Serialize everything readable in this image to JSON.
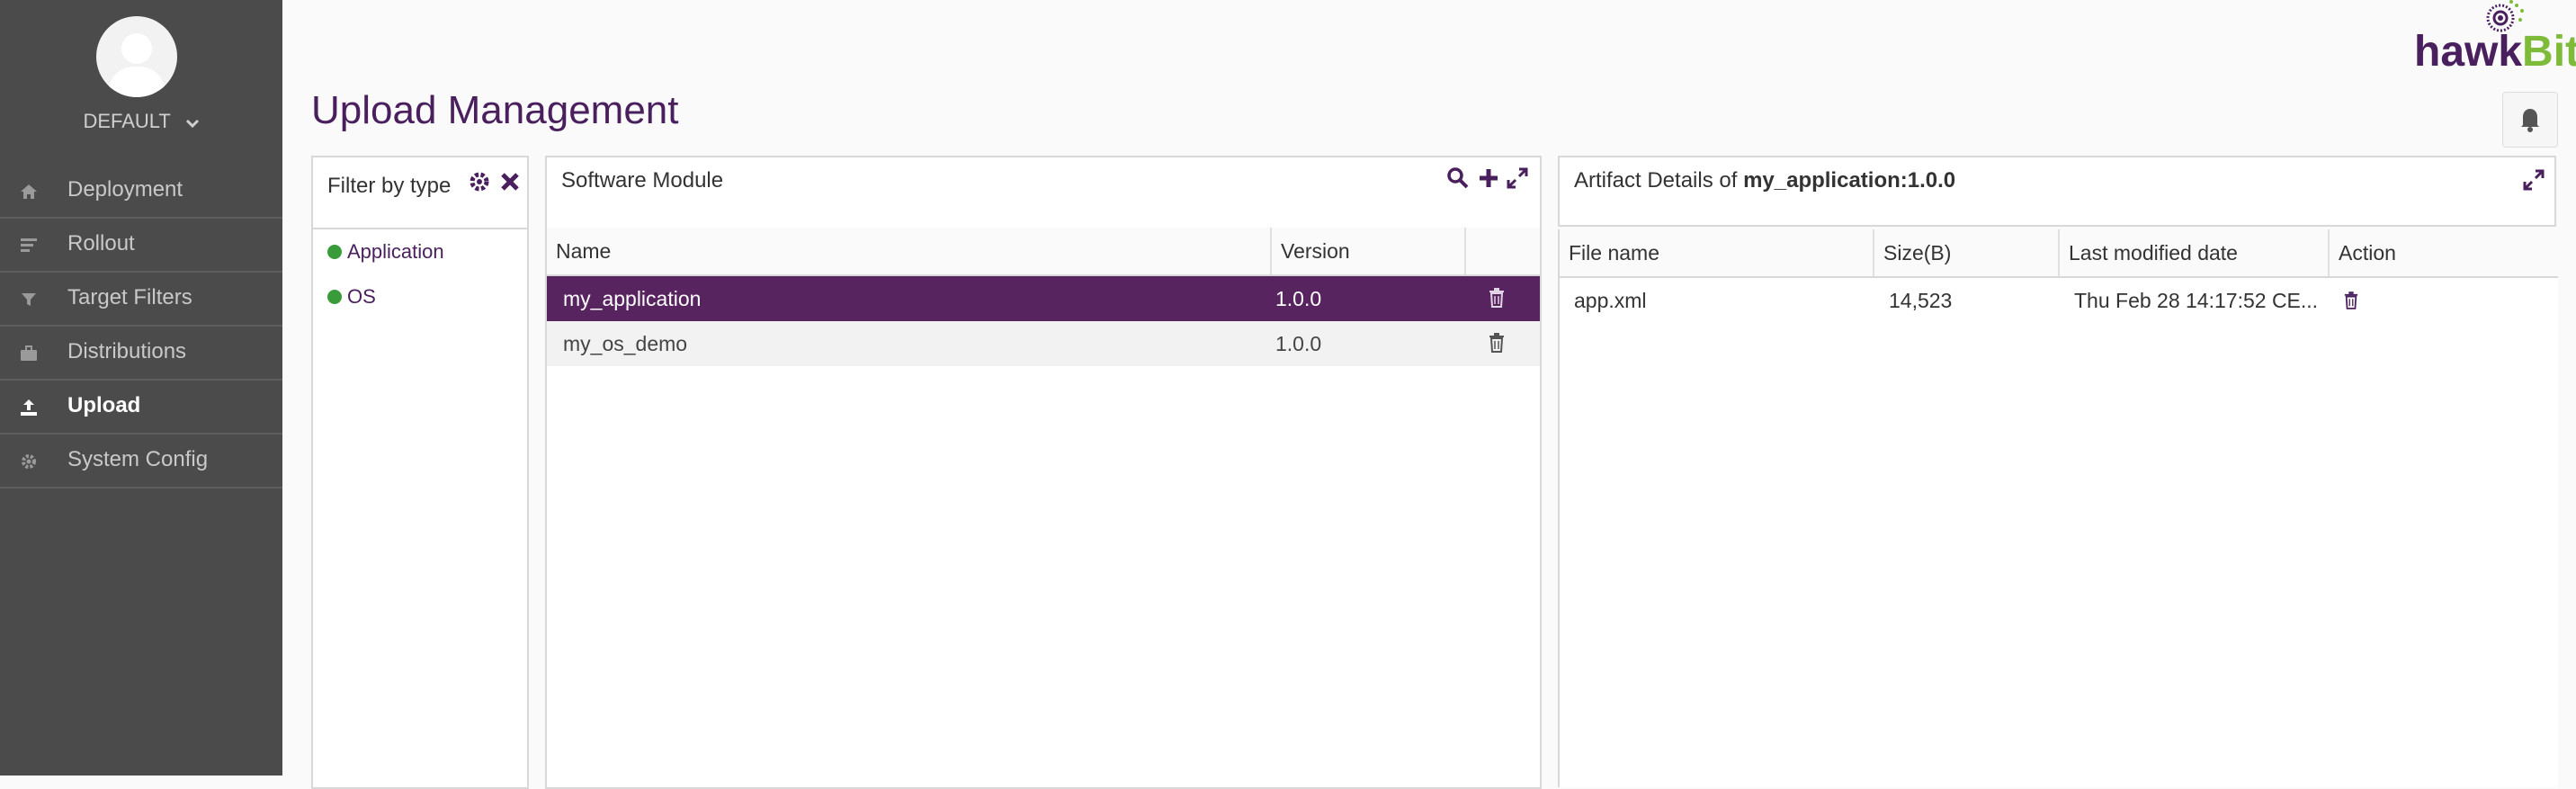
{
  "sidebar": {
    "tenant": "DEFAULT",
    "items": [
      {
        "label": "Deployment",
        "icon": "home-icon"
      },
      {
        "label": "Rollout",
        "icon": "rollout-icon"
      },
      {
        "label": "Target Filters",
        "icon": "filter-icon"
      },
      {
        "label": "Distributions",
        "icon": "briefcase-icon"
      },
      {
        "label": "Upload",
        "icon": "upload-icon",
        "active": true
      },
      {
        "label": "System Config",
        "icon": "gear-icon"
      }
    ]
  },
  "header": {
    "title": "Upload Management",
    "logo": {
      "part1": "hawk",
      "part2": "Bit"
    }
  },
  "filter_panel": {
    "title": "Filter by type",
    "types": [
      {
        "label": "Application",
        "color": "#3a9b3a"
      },
      {
        "label": "OS",
        "color": "#3a9b3a"
      }
    ]
  },
  "software_module": {
    "title": "Software Module",
    "columns": {
      "name": "Name",
      "version": "Version"
    },
    "rows": [
      {
        "name": "my_application",
        "version": "1.0.0"
      },
      {
        "name": "my_os_demo",
        "version": "1.0.0"
      }
    ]
  },
  "artifact_details": {
    "title_prefix": "Artifact Details of ",
    "module": "my_application:1.0.0",
    "columns": {
      "file_name": "File name",
      "size": "Size(B)",
      "modified": "Last modified date",
      "action": "Action"
    },
    "rows": [
      {
        "file_name": "app.xml",
        "size": "14,523",
        "modified": "Thu Feb 28 14:17:52 CE..."
      }
    ]
  },
  "colors": {
    "brand_purple": "#4a1f5e",
    "selected_row": "#58245f",
    "sidebar_bg": "#4b4b4b",
    "logo_green": "#7dbb38",
    "type_dot": "#3a9b3a"
  }
}
